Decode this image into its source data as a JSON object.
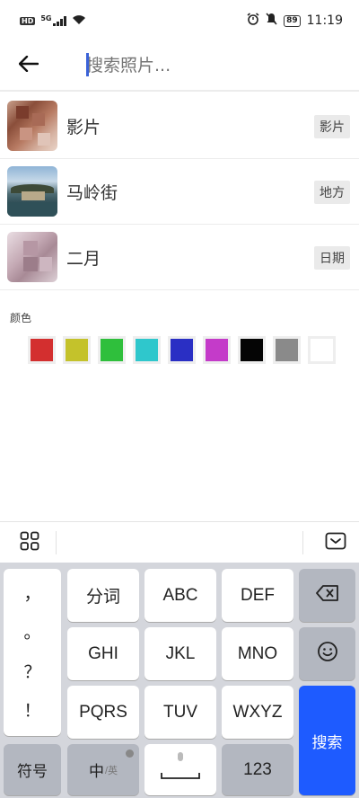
{
  "status_bar": {
    "hd": "HD",
    "network": "5G",
    "battery": "89",
    "time": "11:19"
  },
  "search": {
    "placeholder": "搜索照片..."
  },
  "suggestions": [
    {
      "label": "影片",
      "tag": "影片"
    },
    {
      "label": "马岭街",
      "tag": "地方"
    },
    {
      "label": "二月",
      "tag": "日期"
    }
  ],
  "colors": {
    "title": "颜色",
    "swatches": [
      "#d32f2f",
      "#c4c22b",
      "#2fbf3c",
      "#2fc7cc",
      "#2a2fc4",
      "#c43bc9",
      "#050505",
      "#8a8a8a",
      "#ffffff"
    ]
  },
  "keyboard": {
    "punctuation": [
      "，",
      "。",
      "？",
      "！"
    ],
    "row1": [
      "分词",
      "ABC",
      "DEF"
    ],
    "row2": [
      "GHI",
      "JKL",
      "MNO"
    ],
    "row3": [
      "PQRS",
      "TUV",
      "WXYZ"
    ],
    "symbols_key": "符号",
    "lang_key_main": "中",
    "lang_key_sub": "/英",
    "num_key": "123",
    "search_key": "搜索"
  }
}
